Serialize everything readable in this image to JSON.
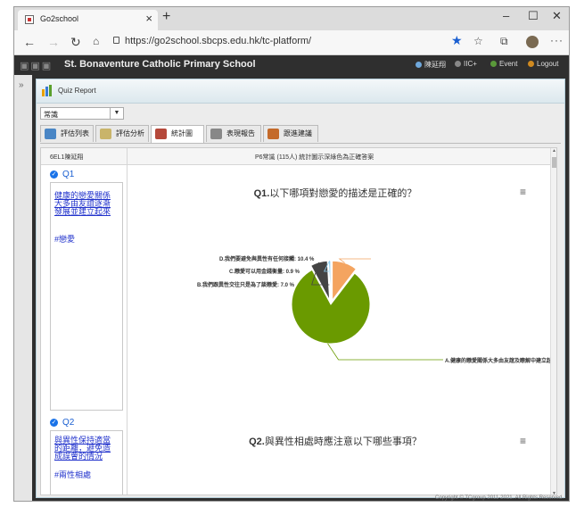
{
  "browser": {
    "tab_title": "Go2school",
    "url": "https://go2school.sbcps.edu.hk/tc-platform/"
  },
  "header": {
    "school_name": "St. Bonaventure Catholic Primary School",
    "user": "陳延翔",
    "iic": "IIC+",
    "event": "Event",
    "logout": "Logout"
  },
  "module": {
    "title": "Quiz Report",
    "subject_select": "常識",
    "tabs": [
      {
        "label": "評估列表"
      },
      {
        "label": "評估分析"
      },
      {
        "label": "統計圖"
      },
      {
        "label": "表現報告"
      },
      {
        "label": "跟進建議"
      }
    ]
  },
  "table": {
    "left_header": "6EL1陳延翔",
    "right_header": "P6常識 (115人) 統計圖示深綠色為正確答案"
  },
  "questions": [
    {
      "num": "Q1",
      "topic": "健康的戀愛關係大多由友誼逐漸發展並建立起來",
      "tag": "#戀愛",
      "chart_title_num": "Q1.",
      "chart_title_text": "以下哪項對戀愛的描述是正確的？"
    },
    {
      "num": "Q2",
      "topic": "與異性保持適當的距離，避免造成誤會的情況",
      "tag": "#兩性相處",
      "chart_title_num": "Q2.",
      "chart_title_text": "與異性相處時應注意以下哪些事項？"
    }
  ],
  "chart_data": {
    "type": "pie",
    "title": "以下哪項對戀愛的描述是正確的？",
    "slices": [
      {
        "label": "A.健康的戀愛關係大多由友誼逐漸發展並建立起來",
        "value": 81.7,
        "color": "#6a9a00",
        "display": "A.健康的戀愛關係大多由友誼及瞭解中建立起來: 81.7 %"
      },
      {
        "label": "B.我們跟異性交往只是為了談戀愛",
        "value": 7.0,
        "color": "#444444",
        "display": "B.我們跟異性交往只是為了談戀愛: 7.0 %"
      },
      {
        "label": "C.戀愛可以用金錢衡量",
        "value": 0.9,
        "color": "#8fd0f0",
        "display": "C.戀愛可以用金錢衡量: 0.9 %"
      },
      {
        "label": "D.我們要避免與異性有任何接觸",
        "value": 10.4,
        "color": "#f4a460",
        "display": "D.我們要避免與異性有任何接觸: 10.4 %"
      }
    ]
  },
  "footer": "Copyright © TCgroup 2011-2021. All Rights Reserved."
}
